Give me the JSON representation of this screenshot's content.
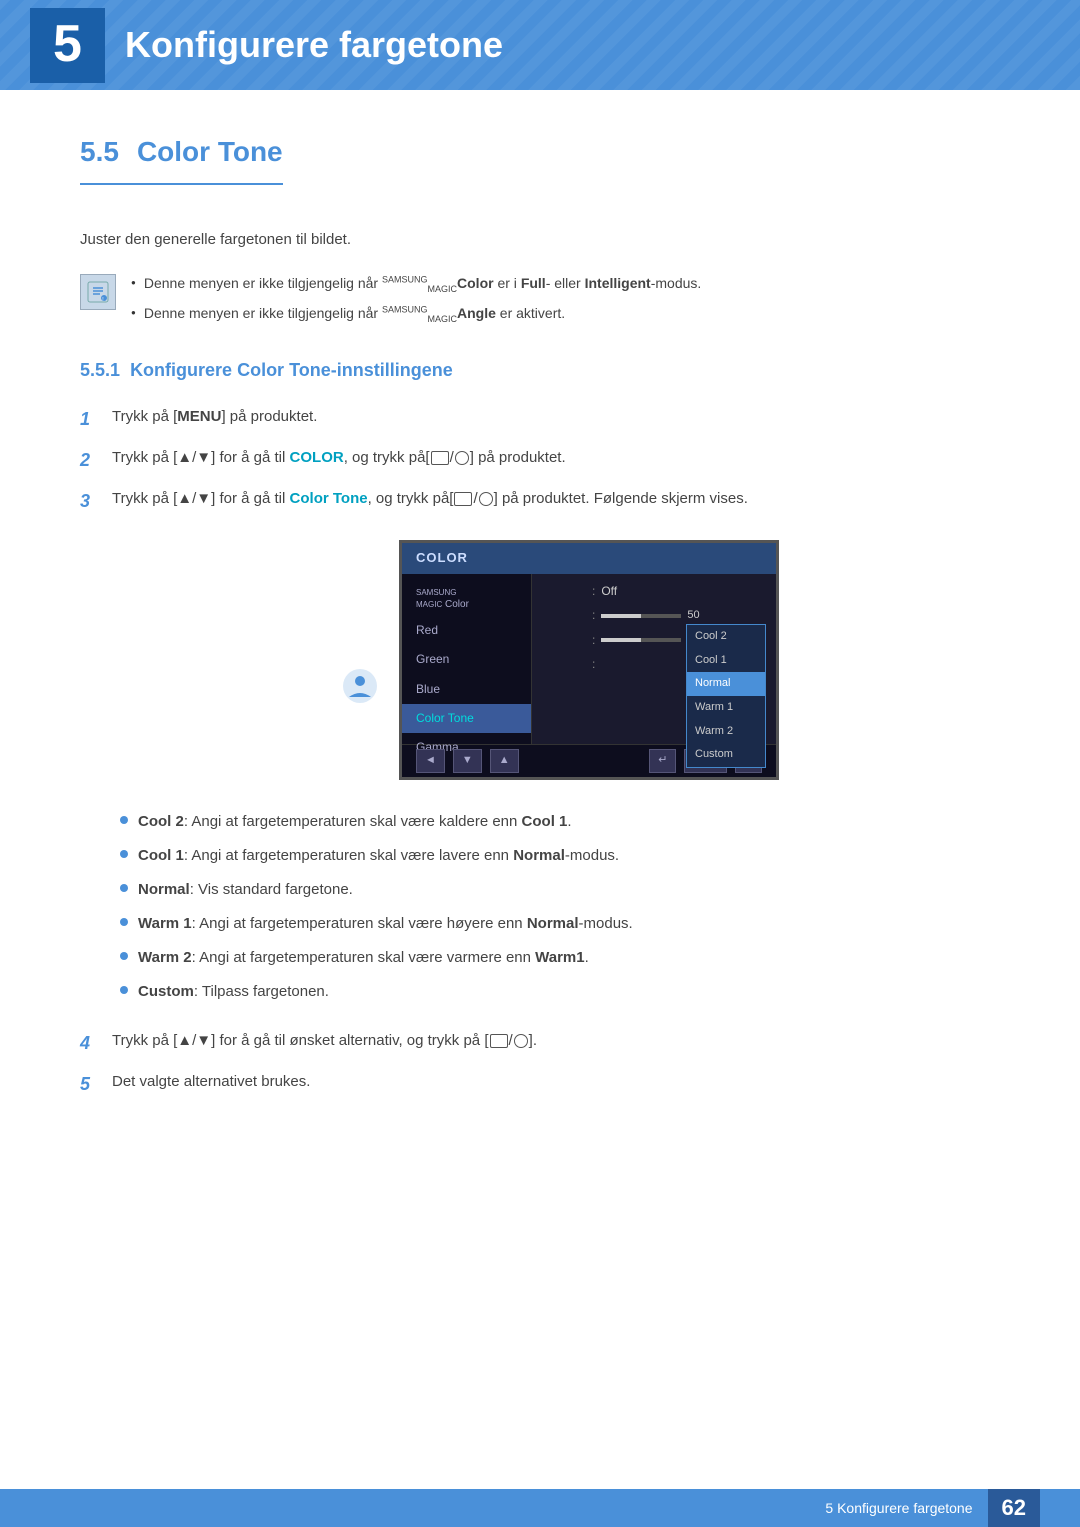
{
  "page": {
    "chapter_num": "5",
    "chapter_title": "Konfigurere fargetone",
    "section_num": "5.5",
    "section_title": "Color Tone",
    "intro_text": "Juster den generelle fargetonen til bildet.",
    "note_lines": [
      {
        "text_before": "Denne menyen er ikke tilgjengelig når ",
        "brand": "SAMSUNG",
        "magic": "MAGIC",
        "product": "Color",
        "text_middle": " er i ",
        "bold1": "Full",
        "text2": "- eller ",
        "bold2": "Intelligent",
        "text3": "-modus."
      },
      {
        "text_before": "Denne menyen er ikke tilgjengelig når ",
        "brand": "SAMSUNG",
        "magic": "MAGIC",
        "product": "Angle",
        "text_after": " er aktivert."
      }
    ],
    "subsection_num": "5.5.1",
    "subsection_title": "Konfigurere Color Tone-innstillingene",
    "steps": [
      {
        "num": "1",
        "text": "Trykk på [",
        "bold": "MENU",
        "text2": "] på produktet."
      },
      {
        "num": "2",
        "text": "Trykk på [▲/▼] for å gå til ",
        "bold": "COLOR",
        "text2": ", og trykk på[□/⊙] på produktet."
      },
      {
        "num": "3",
        "text": "Trykk på [▲/▼] for å gå til ",
        "bold": "Color Tone",
        "text2": ", og trykk på[□/⊙] på produktet. Følgende skjerm vises."
      }
    ],
    "monitor": {
      "title": "COLOR",
      "menu_items": [
        {
          "label": "SAMSUNG MAGIC Color",
          "selected": false,
          "value": "Off",
          "has_value": true
        },
        {
          "label": "Red",
          "selected": false,
          "has_slider": true,
          "slider_val": 50
        },
        {
          "label": "Green",
          "selected": false,
          "has_slider": true,
          "slider_val": 50
        },
        {
          "label": "Blue",
          "selected": false,
          "has_slider": false
        },
        {
          "label": "Color Tone",
          "selected": true,
          "color_tone": true
        },
        {
          "label": "Gamma",
          "selected": false
        }
      ],
      "dropdown_items": [
        {
          "label": "Cool 2",
          "active": false
        },
        {
          "label": "Cool 1",
          "active": false
        },
        {
          "label": "Normal",
          "active": true
        },
        {
          "label": "Warm 1",
          "active": false
        },
        {
          "label": "Warm 2",
          "active": false
        },
        {
          "label": "Custom",
          "active": false
        }
      ]
    },
    "bullet_items": [
      {
        "bold": "Cool 2",
        "text": ": Angi at fargetemperaturen skal være kaldere enn ",
        "bold2": "Cool 1",
        "text2": "."
      },
      {
        "bold": "Cool 1",
        "text": ": Angi at fargetemperaturen skal være lavere enn ",
        "bold2": "Normal",
        "text2": "-modus."
      },
      {
        "bold": "Normal",
        "text": ": Vis standard fargetone.",
        "bold2": "",
        "text2": ""
      },
      {
        "bold": "Warm 1",
        "text": ": Angi at fargetemperaturen skal være høyere enn ",
        "bold2": "Normal",
        "text2": "-modus."
      },
      {
        "bold": "Warm 2",
        "text": ": Angi at fargetemperaturen skal være varmere enn ",
        "bold2": "Warm1",
        "text2": "."
      },
      {
        "bold": "Custom",
        "text": ": Tilpass fargetonen.",
        "bold2": "",
        "text2": ""
      }
    ],
    "step4_text": "Trykk på [▲/▼] for å gå til ønsket alternativ, og trykk på [□/⊙].",
    "step5_text": "Det valgte alternativet brukes.",
    "footer_text": "5 Konfigurere fargetone",
    "footer_num": "62"
  }
}
